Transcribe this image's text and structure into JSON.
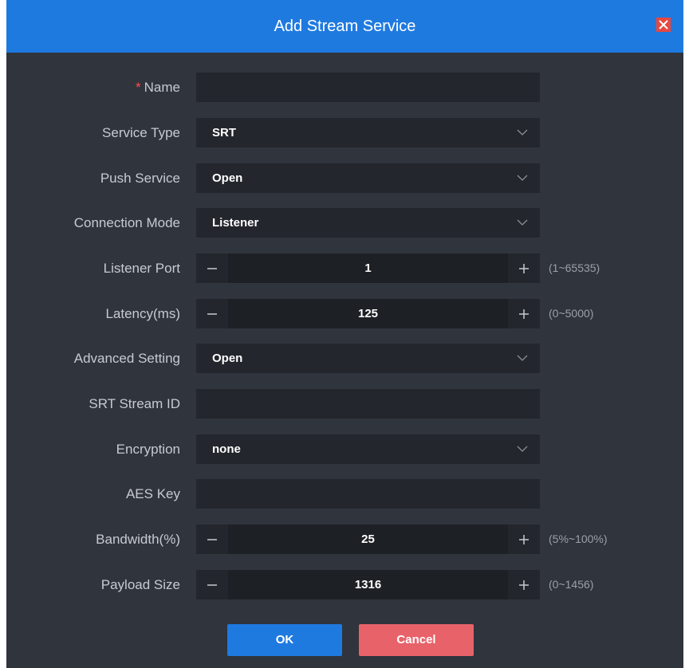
{
  "dialog": {
    "title": "Add Stream Service",
    "close_icon": "close-icon"
  },
  "form": {
    "name": {
      "label": "Name",
      "required_mark": "*",
      "value": ""
    },
    "service_type": {
      "label": "Service Type",
      "value": "SRT"
    },
    "push_service": {
      "label": "Push Service",
      "value": "Open"
    },
    "connection_mode": {
      "label": "Connection Mode",
      "value": "Listener"
    },
    "listener_port": {
      "label": "Listener Port",
      "value": "1",
      "range": "(1~65535)"
    },
    "latency": {
      "label": "Latency(ms)",
      "value": "125",
      "range": "(0~5000)"
    },
    "advanced_setting": {
      "label": "Advanced Setting",
      "value": "Open"
    },
    "srt_stream_id": {
      "label": "SRT Stream ID",
      "value": ""
    },
    "encryption": {
      "label": "Encryption",
      "value": "none"
    },
    "aes_key": {
      "label": "AES Key",
      "value": ""
    },
    "bandwidth": {
      "label": "Bandwidth(%)",
      "value": "25",
      "range": "(5%~100%)"
    },
    "payload_size": {
      "label": "Payload Size",
      "value": "1316",
      "range": "(0~1456)"
    }
  },
  "buttons": {
    "ok": "OK",
    "cancel": "Cancel"
  },
  "colors": {
    "header": "#1f7ae0",
    "panel": "#30343c",
    "field": "#23262c",
    "close": "#e8473f",
    "ok": "#1f7ae0",
    "cancel": "#e8626a"
  }
}
